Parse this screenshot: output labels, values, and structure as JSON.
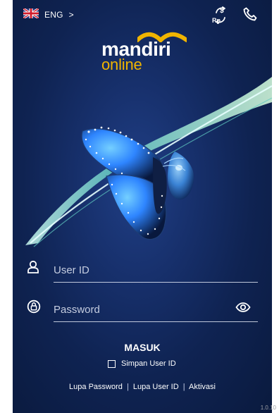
{
  "top_bar": {
    "language_label": "ENG",
    "language_chevron": ">",
    "flag_icon": "uk-flag-icon",
    "currency_icon": "currency-exchange-icon",
    "phone_icon": "phone-icon"
  },
  "brand": {
    "name": "mandiri",
    "sub": "online"
  },
  "form": {
    "user_id_placeholder": "User ID",
    "password_placeholder": "Password",
    "submit_label": "MASUK",
    "remember_label": "Simpan User ID"
  },
  "footer": {
    "links": [
      "Lupa Password",
      "Lupa User ID",
      "Aktivasi"
    ],
    "separator": "|"
  },
  "version": "1.0.10",
  "colors": {
    "background_dark": "#0f2352",
    "brand_gold": "#f0b400",
    "text": "#ffffff"
  }
}
